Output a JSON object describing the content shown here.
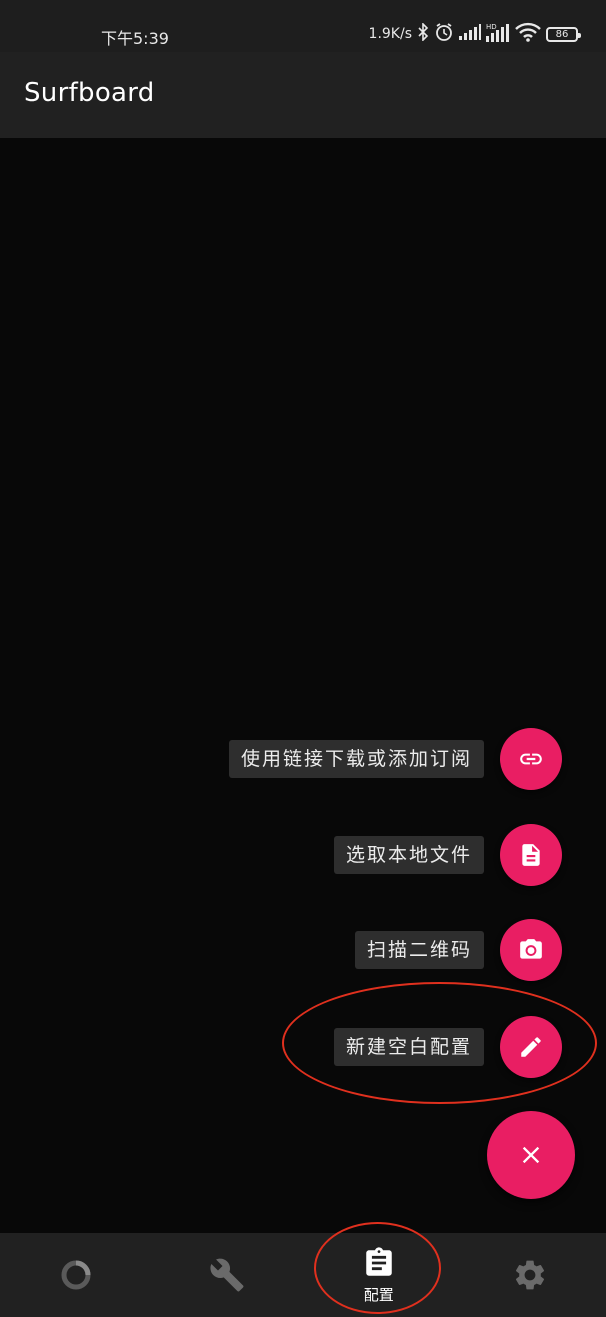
{
  "status_bar": {
    "time": "下午5:39",
    "network_speed": "1.9K/s",
    "battery": "86",
    "icons": [
      "bluetooth-icon",
      "alarm-icon",
      "signal-icon",
      "hd-signal-icon",
      "wifi-icon",
      "battery-icon"
    ]
  },
  "app_bar": {
    "title": "Surfboard"
  },
  "fab_menu": {
    "items": [
      {
        "label": "使用链接下载或添加订阅",
        "icon": "link-icon"
      },
      {
        "label": "选取本地文件",
        "icon": "file-icon"
      },
      {
        "label": "扫描二维码",
        "icon": "camera-icon"
      },
      {
        "label": "新建空白配置",
        "icon": "edit-icon"
      }
    ],
    "main_icon": "close-icon"
  },
  "bottom_nav": {
    "items": [
      {
        "icon": "dashboard-ring-icon",
        "label": ""
      },
      {
        "icon": "wrench-icon",
        "label": ""
      },
      {
        "icon": "clipboard-icon",
        "label": "配置",
        "selected": true
      },
      {
        "icon": "gear-icon",
        "label": ""
      }
    ]
  },
  "colors": {
    "accent": "#e91e63",
    "background": "#080808",
    "bar": "#212121",
    "annotation": "#e0301e"
  }
}
